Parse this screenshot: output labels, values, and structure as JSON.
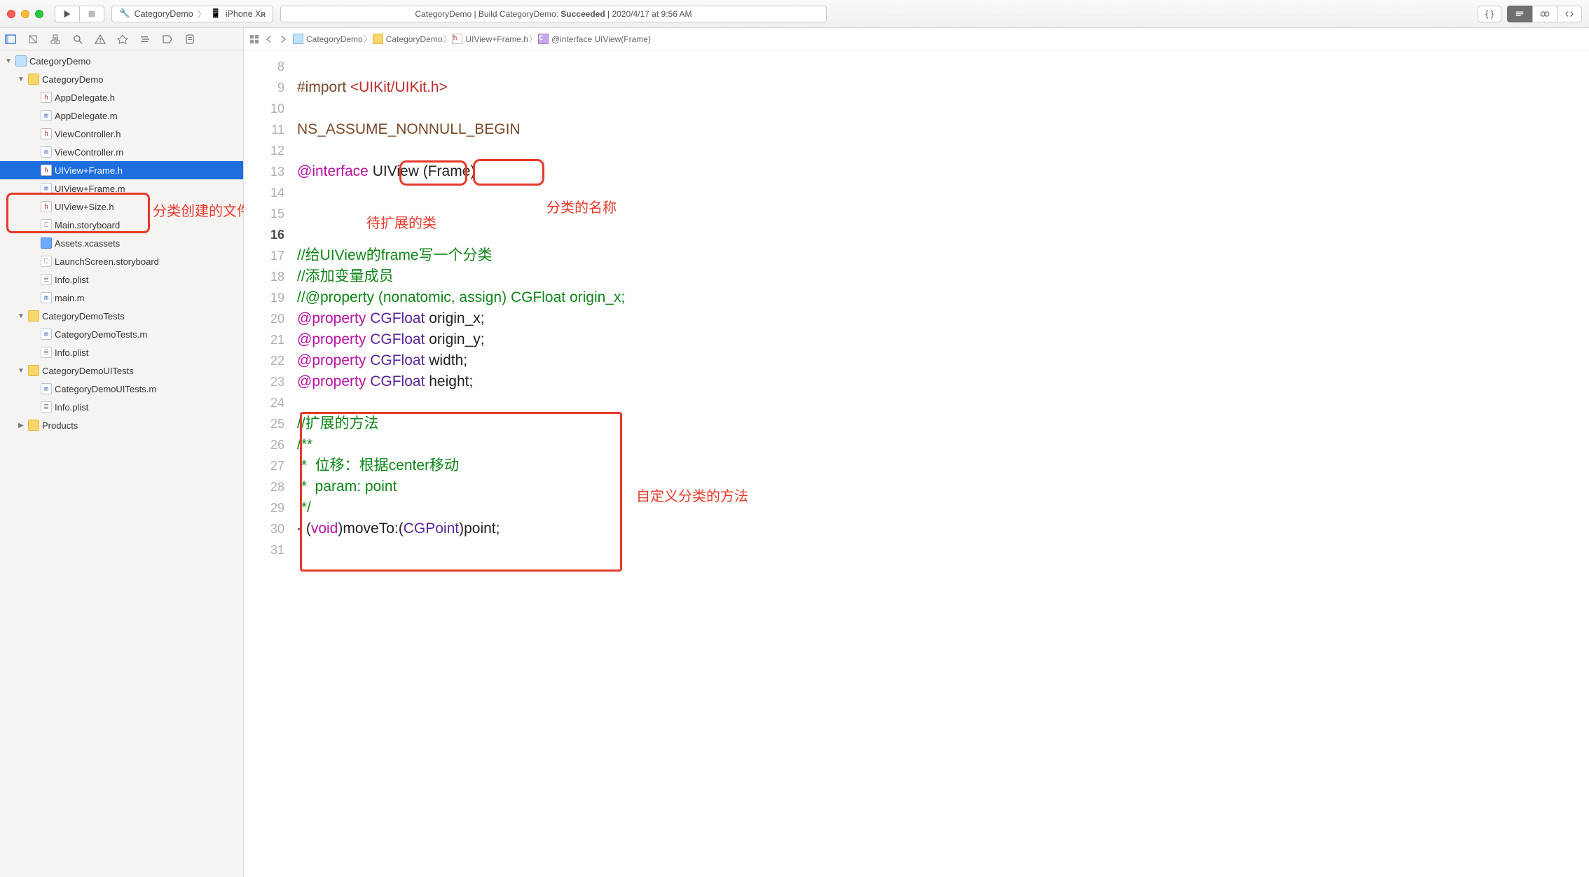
{
  "titlebar": {
    "scheme_name": "CategoryDemo",
    "device": "iPhone X",
    "device_suffix": "R",
    "status_prefix": "CategoryDemo | Build CategoryDemo: ",
    "status_result": "Succeeded",
    "status_time": " | 2020/4/17 at 9:56 AM",
    "braces": "{ }"
  },
  "project_tree": {
    "root": "CategoryDemo",
    "groups": [
      {
        "name": "CategoryDemo",
        "expanded": true,
        "children": [
          {
            "name": "AppDelegate.h",
            "icon": "h"
          },
          {
            "name": "AppDelegate.m",
            "icon": "m"
          },
          {
            "name": "ViewController.h",
            "icon": "h"
          },
          {
            "name": "ViewController.m",
            "icon": "m"
          },
          {
            "name": "UIView+Frame.h",
            "icon": "h",
            "selected": true
          },
          {
            "name": "UIView+Frame.m",
            "icon": "m",
            "boxed": true
          },
          {
            "name": "UIView+Size.h",
            "icon": "h"
          },
          {
            "name": "Main.storyboard",
            "icon": "sb"
          },
          {
            "name": "Assets.xcassets",
            "icon": "bluefolder"
          },
          {
            "name": "LaunchScreen.storyboard",
            "icon": "sb"
          },
          {
            "name": "Info.plist",
            "icon": "plist"
          },
          {
            "name": "main.m",
            "icon": "m"
          }
        ]
      },
      {
        "name": "CategoryDemoTests",
        "expanded": true,
        "children": [
          {
            "name": "CategoryDemoTests.m",
            "icon": "m"
          },
          {
            "name": "Info.plist",
            "icon": "plist"
          }
        ]
      },
      {
        "name": "CategoryDemoUITests",
        "expanded": true,
        "children": [
          {
            "name": "CategoryDemoUITests.m",
            "icon": "m"
          },
          {
            "name": "Info.plist",
            "icon": "plist"
          }
        ]
      },
      {
        "name": "Products",
        "expanded": false,
        "children": []
      }
    ]
  },
  "jumpbar": {
    "items": [
      {
        "icon": "proj",
        "label": "CategoryDemo"
      },
      {
        "icon": "folder",
        "label": "CategoryDemo"
      },
      {
        "icon": "h",
        "label": "UIView+Frame.h"
      },
      {
        "icon": "c",
        "label": "@interface UIView(Frame)"
      }
    ]
  },
  "annotations": {
    "file_box_label": "分类创建的文件",
    "class_to_extend": "待扩展的类",
    "category_name": "分类的名称",
    "custom_methods": "自定义分类的方法"
  },
  "code": {
    "first_line_no": 8,
    "current_line_no": 16,
    "lines": [
      {
        "n": 8,
        "html": ""
      },
      {
        "n": 9,
        "html": "<span class='tok-pp'>#import </span><span class='tok-str'>&lt;UIKit/UIKit.h&gt;</span>"
      },
      {
        "n": 10,
        "html": ""
      },
      {
        "n": 11,
        "html": "<span class='tok-macro'>NS_ASSUME_NONNULL_BEGIN</span>"
      },
      {
        "n": 12,
        "html": ""
      },
      {
        "n": 13,
        "html": "<span class='tok-kw'>@interface</span> <span class='tok-id'>UIView</span> <span class='tok-id'>(Frame)</span>"
      },
      {
        "n": 14,
        "html": ""
      },
      {
        "n": 15,
        "html": ""
      },
      {
        "n": 16,
        "html": ""
      },
      {
        "n": 17,
        "html": "<span class='tok-cmt'>//给UIView的frame写一个分类</span>"
      },
      {
        "n": 18,
        "html": "<span class='tok-cmt'>//添加变量成员</span>"
      },
      {
        "n": 19,
        "html": "<span class='tok-cmt'>//@property (nonatomic, assign) CGFloat origin_x;</span>"
      },
      {
        "n": 20,
        "html": "<span class='tok-kw'>@property</span> <span class='tok-type'>CGFloat</span> <span class='tok-id'>origin_x;</span>"
      },
      {
        "n": 21,
        "html": "<span class='tok-kw'>@property</span> <span class='tok-type'>CGFloat</span> <span class='tok-id'>origin_y;</span>"
      },
      {
        "n": 22,
        "html": "<span class='tok-kw'>@property</span> <span class='tok-type'>CGFloat</span> <span class='tok-id'>width;</span>"
      },
      {
        "n": 23,
        "html": "<span class='tok-kw'>@property</span> <span class='tok-type'>CGFloat</span> <span class='tok-id'>height;</span>"
      },
      {
        "n": 24,
        "html": ""
      },
      {
        "n": 25,
        "html": "<span class='tok-cmt'>//扩展的方法</span>"
      },
      {
        "n": 26,
        "html": "<span class='tok-cmt'>/**</span>"
      },
      {
        "n": 27,
        "html": "<span class='tok-cmt'> *  位移：根据center移动</span>"
      },
      {
        "n": 28,
        "html": "<span class='tok-cmt'> *  param: point</span>"
      },
      {
        "n": 29,
        "html": "<span class='tok-cmt'> */</span>"
      },
      {
        "n": 30,
        "html": "<span class='tok-id'>- (</span><span class='tok-kw'>void</span><span class='tok-id'>)moveTo:(</span><span class='tok-type'>CGPoint</span><span class='tok-id'>)point;</span>"
      },
      {
        "n": 31,
        "html": ""
      }
    ]
  }
}
